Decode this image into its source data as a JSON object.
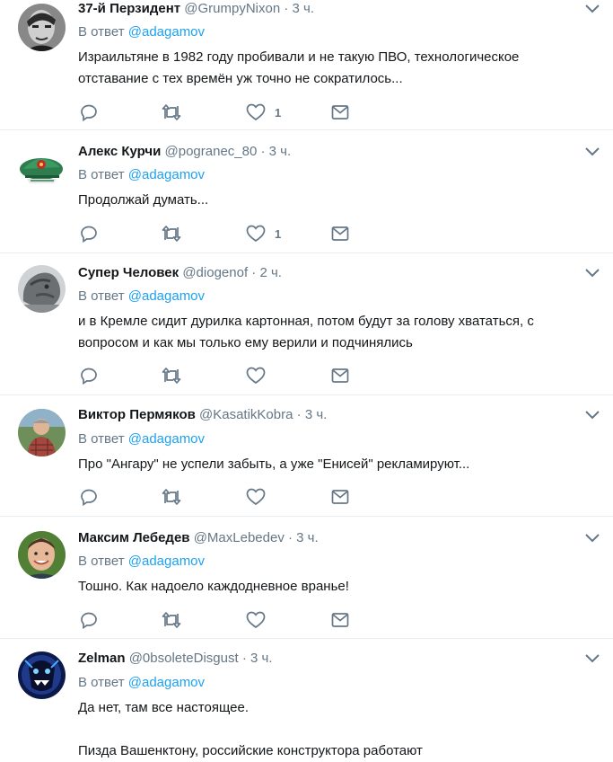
{
  "reply_prefix": "В ответ",
  "tweets": [
    {
      "fullname": "37-й Перзидент",
      "username": "@GrumpyNixon",
      "sep": "·",
      "time": "3 ч.",
      "reply_to": "@adagamov",
      "text": "Израильтяне в 1982 году пробивали и не такую ПВО, технологическое\nотставание с тех времён уж точно не сократилось...",
      "like_count": "1"
    },
    {
      "fullname": "Алекс Курчи",
      "username": "@pogranec_80",
      "sep": "·",
      "time": "3 ч.",
      "reply_to": "@adagamov",
      "text": "Продолжай думать...",
      "like_count": "1"
    },
    {
      "fullname": "Супер Человек",
      "username": "@diogenof",
      "sep": "·",
      "time": "2 ч.",
      "reply_to": "@adagamov",
      "text": "и в Кремле сидит дурилка картонная, потом будут за голову хвататься, с\nвопросом и как мы только ему верили и подчинялись",
      "like_count": ""
    },
    {
      "fullname": "Виктор Пермяков",
      "username": "@KasatikKobra",
      "sep": "·",
      "time": "3 ч.",
      "reply_to": "@adagamov",
      "text": "Про \"Ангару\" не успели забыть, а уже \"Енисей\" рекламируют...",
      "like_count": ""
    },
    {
      "fullname": "Максим Лебедев",
      "username": "@MaxLebedev",
      "sep": "·",
      "time": "3 ч.",
      "reply_to": "@adagamov",
      "text": "Тошно. Как надоело каждодневное вранье!",
      "like_count": ""
    },
    {
      "fullname": "Zelman",
      "username": "@0bsoleteDisgust",
      "sep": "·",
      "time": "3 ч.",
      "reply_to": "@adagamov",
      "text": "Да нет, там все настоящее.\n\nПизда Вашенктону, российские конструктора работают",
      "like_count": ""
    }
  ],
  "colors": {
    "link": "#1da1f2",
    "secondary": "#657786",
    "divider": "#e6ecf0"
  },
  "icons": {
    "reply": "reply-icon",
    "retweet": "retweet-icon",
    "like": "heart-icon",
    "dm": "envelope-icon",
    "menu": "chevron-down-icon"
  }
}
